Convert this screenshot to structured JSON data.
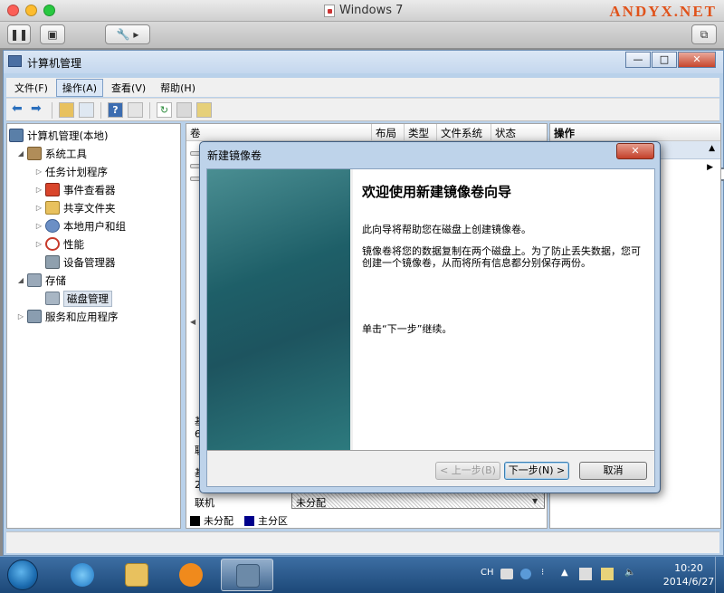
{
  "host": {
    "title": "Windows 7",
    "brand": "ANDYX.NET"
  },
  "window": {
    "title": "计算机管理",
    "ctrl_min": "—",
    "ctrl_max": "□",
    "ctrl_close": "✕"
  },
  "menu": [
    {
      "label": "文件(F)",
      "active": false
    },
    {
      "label": "操作(A)",
      "active": true
    },
    {
      "label": "查看(V)",
      "active": false
    },
    {
      "label": "帮助(H)",
      "active": false
    }
  ],
  "tree": {
    "root": "计算机管理(本地)",
    "system_tools": "系统工具",
    "task_scheduler": "任务计划程序",
    "event_viewer": "事件查看器",
    "shared_folders": "共享文件夹",
    "local_users": "本地用户和组",
    "performance": "性能",
    "device_manager": "设备管理器",
    "storage": "存储",
    "disk_management": "磁盘管理",
    "services": "服务和应用程序"
  },
  "columns": [
    "卷",
    "布局",
    "类型",
    "文件系统",
    "状态"
  ],
  "disk_area": {
    "label_a": "基",
    "label_b": "6",
    "label_c": "联",
    "label_d": "基",
    "label_e": "2",
    "online": "联机",
    "unallocated": "未分配"
  },
  "legend": [
    {
      "label": "未分配",
      "color": "#000000"
    },
    {
      "label": "主分区",
      "color": "#00008b"
    }
  ],
  "actions": {
    "header": "操作"
  },
  "dialog": {
    "title": "新建镜像卷",
    "close": "✕",
    "heading": "欢迎使用新建镜像卷向导",
    "p1": "此向导将帮助您在磁盘上创建镜像卷。",
    "p2": "镜像卷将您的数据复制在两个磁盘上。为了防止丢失数据，您可创建一个镜像卷，从而将所有信息都分别保存两份。",
    "p3": "单击“下一步”继续。",
    "back": "< 上一步(B)",
    "next": "下一步(N) >",
    "cancel": "取消"
  },
  "tray": {
    "lang": "CH"
  },
  "clock": {
    "time": "10:20",
    "date": "2014/6/27"
  }
}
